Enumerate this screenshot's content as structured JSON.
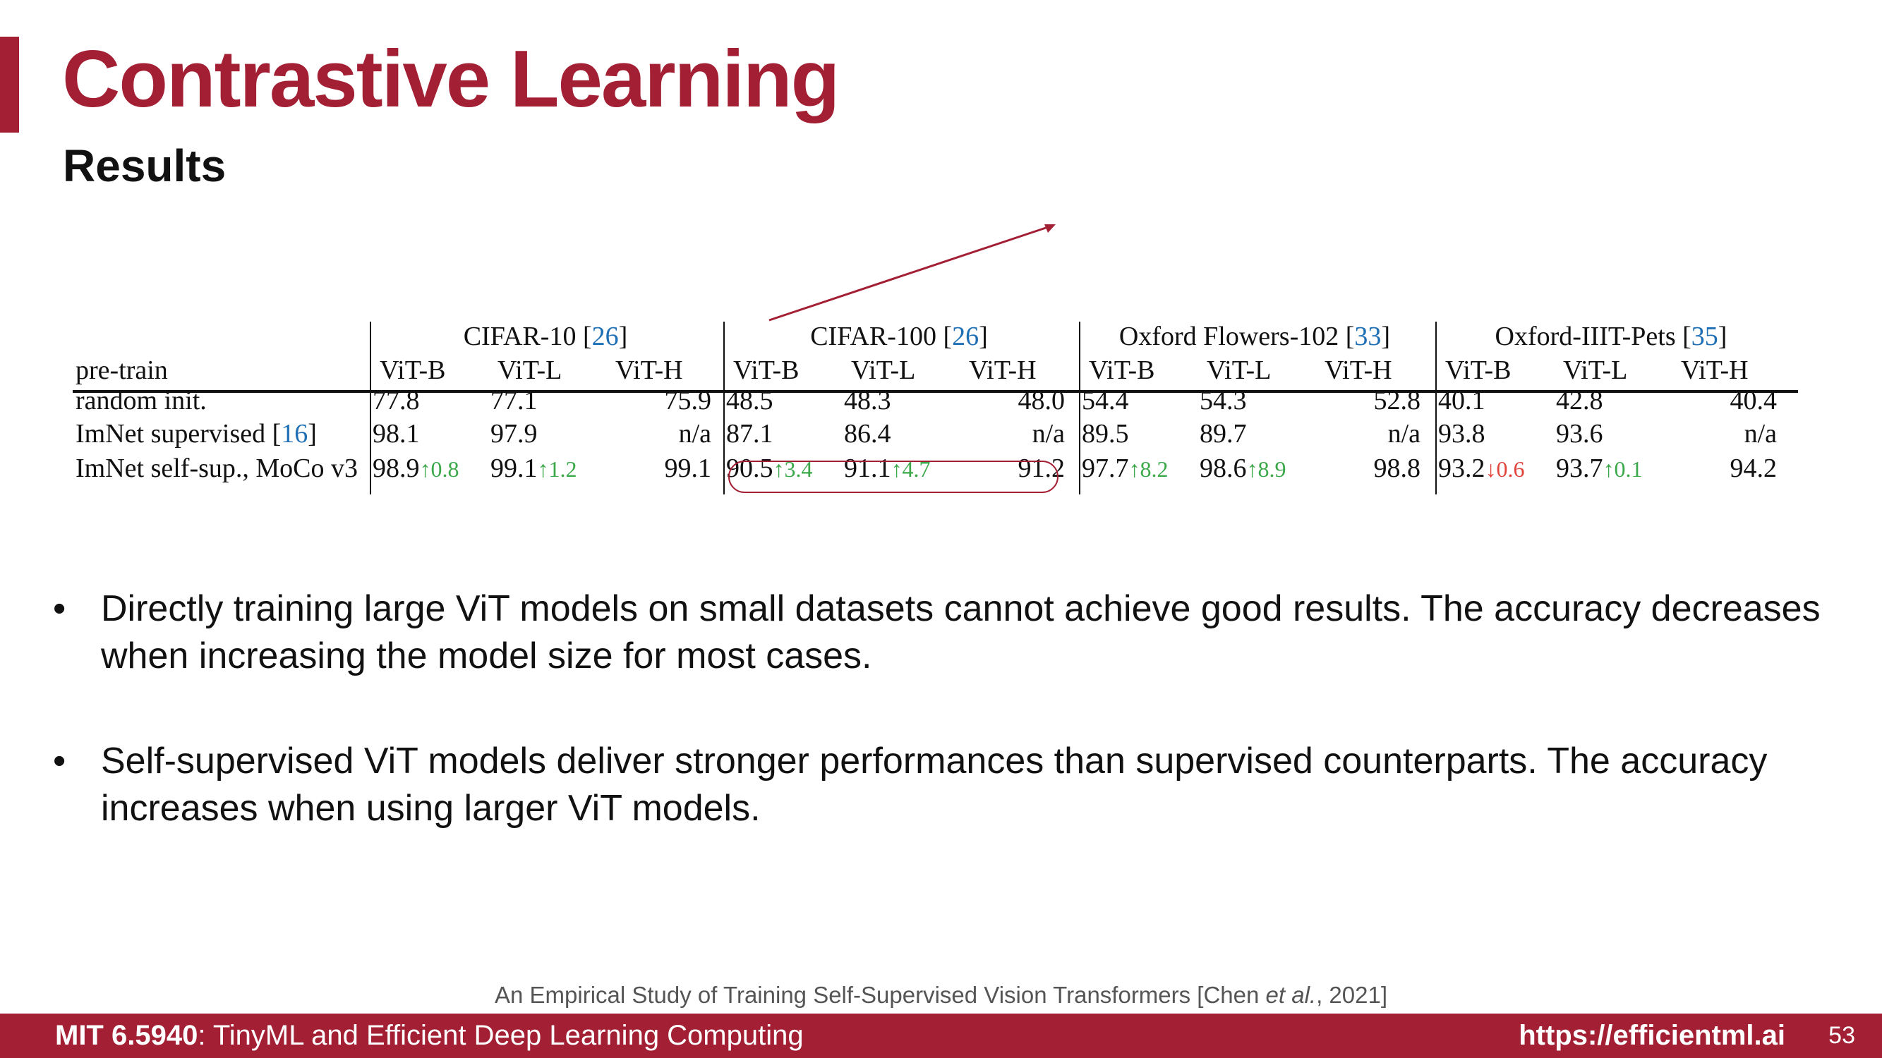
{
  "header": {
    "title": "Contrastive Learning",
    "subtitle": "Results"
  },
  "table": {
    "pretrain_label": "pre-train",
    "datasets": [
      {
        "name": "CIFAR-10 [",
        "ref": "26",
        "close": "]"
      },
      {
        "name": "CIFAR-100 [",
        "ref": "26",
        "close": "]"
      },
      {
        "name": "Oxford Flowers-102 [",
        "ref": "33",
        "close": "]"
      },
      {
        "name": "Oxford-IIIT-Pets [",
        "ref": "35",
        "close": "]"
      }
    ],
    "models": [
      "ViT-B",
      "ViT-L",
      "ViT-H"
    ],
    "rows": [
      {
        "label": "random init.",
        "ref": "",
        "values": [
          [
            "77.8",
            "77.1",
            "75.9"
          ],
          [
            "48.5",
            "48.3",
            "48.0"
          ],
          [
            "54.4",
            "54.3",
            "52.8"
          ],
          [
            "40.1",
            "42.8",
            "40.4"
          ]
        ],
        "deltas": [
          [
            "",
            ""
          ],
          [
            "",
            ""
          ],
          [
            "",
            ""
          ],
          [
            "",
            ""
          ]
        ]
      },
      {
        "label": "ImNet supervised [",
        "ref": "16",
        "close": "]",
        "values": [
          [
            "98.1",
            "97.9",
            "n/a"
          ],
          [
            "87.1",
            "86.4",
            "n/a"
          ],
          [
            "89.5",
            "89.7",
            "n/a"
          ],
          [
            "93.8",
            "93.6",
            "n/a"
          ]
        ],
        "deltas": [
          [
            "",
            ""
          ],
          [
            "",
            ""
          ],
          [
            "",
            ""
          ],
          [
            "",
            ""
          ]
        ]
      },
      {
        "label": "ImNet self-sup., MoCo v3",
        "ref": "",
        "values": [
          [
            "98.9",
            "99.1",
            "99.1"
          ],
          [
            "90.5",
            "91.1",
            "91.2"
          ],
          [
            "97.7",
            "98.6",
            "98.8"
          ],
          [
            "93.2",
            "93.7",
            "94.2"
          ]
        ],
        "deltas": [
          [
            "↑0.8",
            "↑1.2"
          ],
          [
            "↑3.4",
            "↑4.7"
          ],
          [
            "↑8.2",
            "↑8.9"
          ],
          [
            "↓0.6",
            "↑0.1"
          ]
        ],
        "delta_dirs": [
          [
            "up",
            "up"
          ],
          [
            "up",
            "up"
          ],
          [
            "up",
            "up"
          ],
          [
            "down",
            "up"
          ]
        ]
      }
    ]
  },
  "bullets": [
    "Directly training large ViT models on small datasets cannot achieve good results. The accuracy decreases when increasing the model size for most cases.",
    "Self-supervised ViT models deliver stronger performances than supervised counterparts. The accuracy increases when using larger ViT models."
  ],
  "bullet_symbol": "•",
  "citation": {
    "prefix": "An Empirical Study of Training Self-Supervised Vision Transformers [Chen ",
    "italic": "et al.",
    "suffix": ", 2021]"
  },
  "footer": {
    "course_code": "MIT 6.5940",
    "course_name": ": TinyML and Efficient Deep Learning Computing",
    "url": "https://efficientml.ai",
    "page_number": "53"
  },
  "colors": {
    "brand": "#a31f34",
    "ref_link": "#1f6fb4",
    "increase": "#3ba84a",
    "decrease": "#e0443b"
  }
}
